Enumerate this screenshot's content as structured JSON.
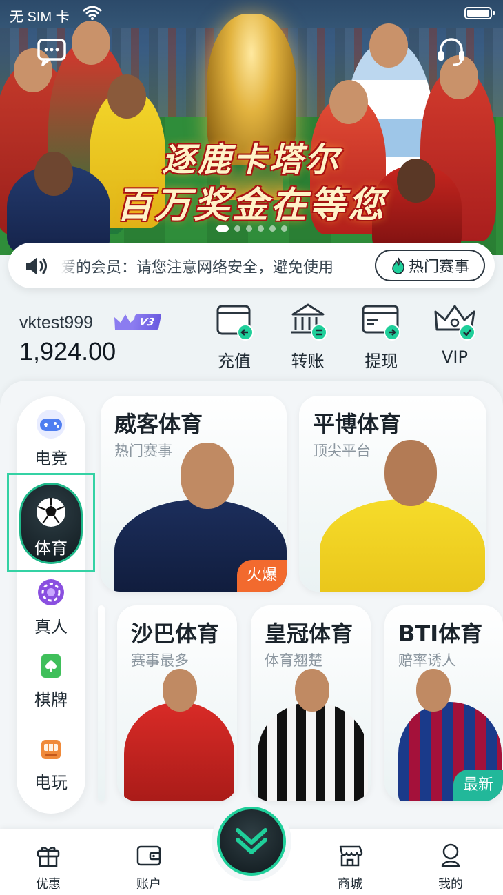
{
  "status_bar": {
    "carrier": "无 SIM 卡"
  },
  "banner": {
    "slogan_line1": "逐鹿卡塔尔",
    "slogan_line2": "百万奖金在等您",
    "slide_count": 6,
    "active_slide": 0
  },
  "marquee": {
    "text": "爱的会员：请您注意网络安全，避免使用",
    "hot_button": "热门赛事"
  },
  "user": {
    "username": "vktest999",
    "vip_level": "V3",
    "balance": "1,924.00"
  },
  "actions": [
    {
      "label": "充值",
      "icon": "wallet-deposit-icon"
    },
    {
      "label": "转账",
      "icon": "bank-transfer-icon"
    },
    {
      "label": "提现",
      "icon": "card-withdraw-icon"
    },
    {
      "label": "VIP",
      "icon": "crown-vip-icon"
    }
  ],
  "sidebar": [
    {
      "label": "电竞",
      "icon": "gamepad-icon"
    },
    {
      "label": "体育",
      "icon": "soccer-ball-icon",
      "active": true
    },
    {
      "label": "真人",
      "icon": "casino-chip-icon"
    },
    {
      "label": "棋牌",
      "icon": "poker-card-icon"
    },
    {
      "label": "电玩",
      "icon": "slot-machine-icon"
    }
  ],
  "venues": [
    {
      "title": "威客体育",
      "subtitle": "热门赛事",
      "tag": "火爆"
    },
    {
      "title": "平博体育",
      "subtitle": "顶尖平台"
    },
    {
      "title": "沙巴体育",
      "subtitle": "赛事最多"
    },
    {
      "title": "皇冠体育",
      "subtitle": "体育翘楚"
    },
    {
      "title": "BTI体育",
      "subtitle": "赔率诱人",
      "tag": "最新"
    }
  ],
  "bottom_nav": [
    {
      "label": "优惠",
      "icon": "gift-icon"
    },
    {
      "label": "账户",
      "icon": "wallet-icon"
    },
    {
      "label": "商城",
      "icon": "store-icon"
    },
    {
      "label": "我的",
      "icon": "user-icon"
    }
  ],
  "colors": {
    "accent": "#1fcf9a",
    "hot_tag": "#f26a2e",
    "new_tag": "#22b89a",
    "vip_badge": "#7a6ae6"
  }
}
